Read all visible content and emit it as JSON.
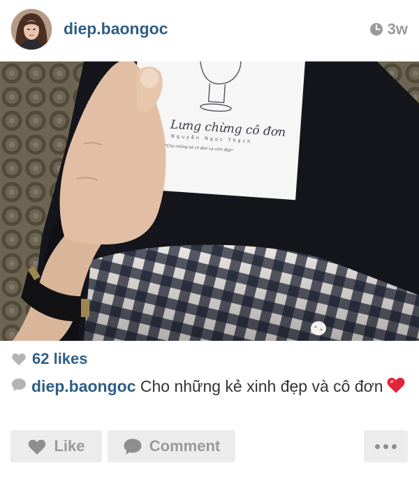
{
  "post": {
    "username": "diep.baongoc",
    "time_ago": "3w",
    "likes": "62 likes",
    "caption_user": "diep.baongoc",
    "caption_text": "Cho những kẻ xinh đẹp và cô đơn",
    "caption_emoji": "red-heart-emoji"
  },
  "photo": {
    "book_title": "Lưng chừng cô đơn",
    "book_author": "Nguyễn Ngọc Thạch",
    "book_tagline": "*Cho những kẻ cô đơn và xinh đẹp*"
  },
  "actions": {
    "like_label": "Like",
    "comment_label": "Comment"
  },
  "icons": {
    "time": "clock-icon",
    "likes": "heart-icon",
    "caption": "speech-bubble-icon",
    "more": "ellipsis-icon"
  },
  "colors": {
    "username": "#2e5e86",
    "muted": "#9a9a9a",
    "button_bg": "#ececec",
    "heart_emoji": "#e0243a"
  }
}
